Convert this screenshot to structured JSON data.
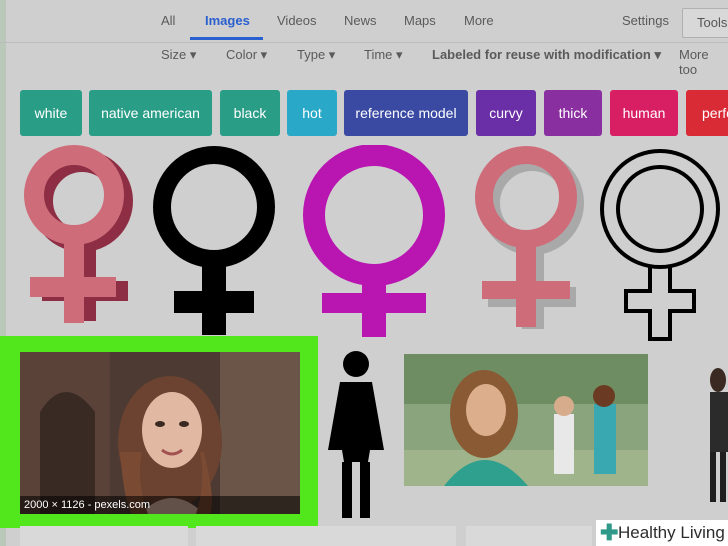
{
  "nav": {
    "tabs": [
      "All",
      "Images",
      "Videos",
      "News",
      "Maps",
      "More"
    ],
    "settings": "Settings",
    "tools": "Tools"
  },
  "filters": [
    "Size ▾",
    "Color ▾",
    "Type ▾",
    "Time ▾",
    "Labeled for reuse with modification ▾",
    "More too"
  ],
  "chips": [
    {
      "label": "white",
      "color": "#2a9d87"
    },
    {
      "label": "native american",
      "color": "#2a9d87"
    },
    {
      "label": "black",
      "color": "#2a9d87"
    },
    {
      "label": "hot",
      "color": "#2aa8c7"
    },
    {
      "label": "reference model",
      "color": "#3a4aa3"
    },
    {
      "label": "curvy",
      "color": "#6a2fa7"
    },
    {
      "label": "thick",
      "color": "#8a2f9f"
    },
    {
      "label": "human",
      "color": "#d81f64"
    },
    {
      "label": "perfe",
      "color": "#d82b35"
    }
  ],
  "results": {
    "selected_caption": "2000 × 1126 - pexels.com"
  },
  "colors": {
    "highlight": "#52e61d",
    "pink_symbol": "#cf6c7a",
    "magenta_symbol": "#b915b1",
    "black": "#000000"
  },
  "watermark": {
    "icon": "plus-icon",
    "text": "Healthy Living"
  }
}
